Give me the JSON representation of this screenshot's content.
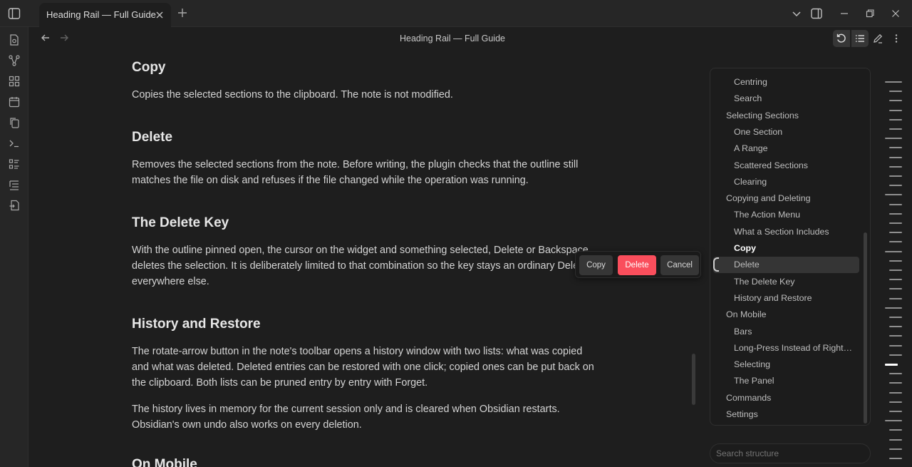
{
  "tab": {
    "title": "Heading Rail — Full Guide"
  },
  "view": {
    "title": "Heading Rail — Full Guide"
  },
  "ribbon": {
    "icons": [
      "file-icon",
      "graph-icon",
      "grid-icon",
      "calendar-icon",
      "copy-icon",
      "terminal-icon",
      "list-icon",
      "outline-list-icon",
      "export-icon"
    ]
  },
  "content": {
    "sections": [
      {
        "heading": "Copy",
        "paragraphs": [
          "Copies the selected sections to the clipboard. The note is not modified."
        ]
      },
      {
        "heading": "Delete",
        "paragraphs": [
          "Removes the selected sections from the note. Before writing, the plugin checks that the outline still matches the file on disk and refuses if the file changed while the operation was running."
        ]
      },
      {
        "heading": "The Delete Key",
        "paragraphs": [
          "With the outline pinned open, the cursor on the widget and something selected, Delete or Backspace deletes the selection. It is deliberately limited to that combination so the key stays an ordinary Delete everywhere else."
        ]
      },
      {
        "heading": "History and Restore",
        "paragraphs": [
          "The rotate-arrow button in the note's toolbar opens a history window with two lists: what was copied and what was deleted. Deleted entries can be restored with one click; copied ones can be put back on the clipboard. Both lists can be pruned entry by entry with Forget.",
          "The history lives in memory for the current session only and is cleared when Obsidian restarts. Obsidian's own undo also works on every deletion."
        ]
      },
      {
        "heading": "On Mobile",
        "paragraphs": []
      }
    ]
  },
  "action_menu": {
    "copy": "Copy",
    "delete": "Delete",
    "cancel": "Cancel",
    "delete_color": "#fa4e5c"
  },
  "outline": {
    "items": [
      {
        "label": "Centring",
        "level": 2
      },
      {
        "label": "Search",
        "level": 2
      },
      {
        "label": "Selecting Sections",
        "level": 1
      },
      {
        "label": "One Section",
        "level": 2
      },
      {
        "label": "A Range",
        "level": 2
      },
      {
        "label": "Scattered Sections",
        "level": 2
      },
      {
        "label": "Clearing",
        "level": 2
      },
      {
        "label": "Copying and Deleting",
        "level": 1
      },
      {
        "label": "The Action Menu",
        "level": 2
      },
      {
        "label": "What a Section Includes",
        "level": 2
      },
      {
        "label": "Copy",
        "level": 2,
        "state": "bold"
      },
      {
        "label": "Delete",
        "level": 2,
        "state": "active"
      },
      {
        "label": "The Delete Key",
        "level": 2
      },
      {
        "label": "History and Restore",
        "level": 2
      },
      {
        "label": "On Mobile",
        "level": 1
      },
      {
        "label": "Bars",
        "level": 2
      },
      {
        "label": "Long-Press Instead of Right-Click",
        "level": 2
      },
      {
        "label": "Selecting",
        "level": 2
      },
      {
        "label": "The Panel",
        "level": 2
      },
      {
        "label": "Commands",
        "level": 1
      },
      {
        "label": "Settings",
        "level": 1
      }
    ]
  },
  "search": {
    "placeholder": "Search structure"
  },
  "rail": {
    "tick_count": 41,
    "current_index": 30
  }
}
